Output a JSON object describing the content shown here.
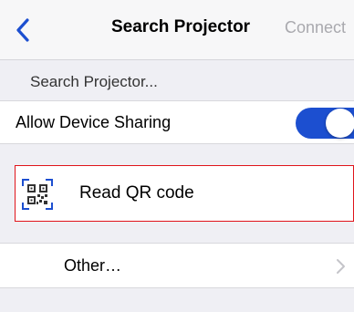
{
  "navbar": {
    "back_icon": "chevron-left-icon",
    "title": "Search Projector",
    "right_tab": "Connect"
  },
  "section": {
    "header": "Search Projector..."
  },
  "sharing": {
    "label": "Allow Device Sharing",
    "enabled": true,
    "toggle_color": "#1c4fd0"
  },
  "qr": {
    "icon": "qr-code-icon",
    "label": "Read QR code",
    "highlight_color": "#e0141b"
  },
  "other": {
    "label": "Other…",
    "chevron_icon": "chevron-right-icon"
  }
}
